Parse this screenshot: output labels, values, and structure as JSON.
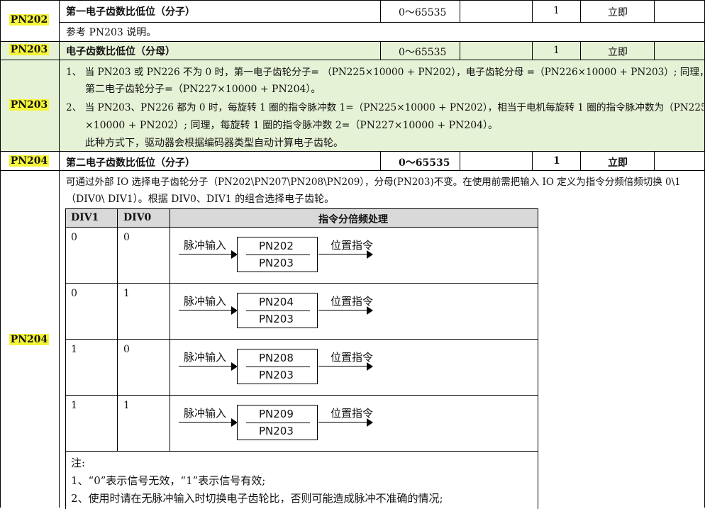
{
  "rows": {
    "pn202": {
      "param": "PN202",
      "name": "第一电子齿数比低位（分子）",
      "range": "0～65535",
      "unit": "",
      "default": "1",
      "effect": "立即",
      "desc": "参考 PN203 说明。"
    },
    "pn203": {
      "param": "PN203",
      "name": "电子齿数比低位（分母）",
      "range": "0～65535",
      "unit": "",
      "default": "1",
      "effect": "立即",
      "param_desc": "PN203",
      "desc_lines": [
        "1、  当 PN203 或 PN226 不为 0 时，第一电子齿轮分子=  （PN225×10000 + PN202），电子齿轮分母 =（PN226×10000 + PN203）; 同理，",
        "第二电子齿轮分子=（PN227×10000 + PN204）。",
        "2、  当 PN203、PN226 都为 0 时，每旋转 1 圈的指令脉冲数 1=（PN225×10000 + PN202），相当于电机每旋转 1 圈的指令脉冲数为（PN225",
        "×10000 + PN202）; 同理，每旋转 1 圈的指令脉冲数 2=（PN227×10000 + PN204）。",
        "此种方式下，驱动器会根据编码器类型自动计算电子齿轮。"
      ]
    },
    "pn204": {
      "param": "PN204",
      "name": "第二电子齿数比低位（分子）",
      "range": "0～65535",
      "unit": "",
      "default": "1",
      "effect": "立即",
      "param_desc": "PN204",
      "desc_lines": [
        "可通过外部 IO 选择电子齿轮分子（PN202\\PN207\\PN208\\PN209），分母(PN203)不变。在使用前需把输入 IO 定义为指令分频倍频切换 0\\1",
        "（DIV0\\ DIV1）。根据 DIV0、DIV1 的组合选择电子齿轮。"
      ]
    }
  },
  "inner_table": {
    "headers": [
      "DIV1",
      "DIV0",
      "指令分倍频处理"
    ],
    "rows": [
      {
        "div1": "0",
        "div0": "0",
        "numerator": "PN202",
        "denominator": "PN203"
      },
      {
        "div1": "0",
        "div0": "1",
        "numerator": "PN204",
        "denominator": "PN203"
      },
      {
        "div1": "1",
        "div0": "0",
        "numerator": "PN208",
        "denominator": "PN203"
      },
      {
        "div1": "1",
        "div0": "1",
        "numerator": "PN209",
        "denominator": "PN203"
      }
    ],
    "input_label": "脉冲输入",
    "output_label": "位置指令"
  },
  "notes": {
    "title": "注:",
    "items": [
      "1、“0”表示信号无效，“1”表示信号有效;",
      "2、使用时请在无脉冲输入时切换电子齿轮比，否则可能造成脉冲不准确的情况;"
    ]
  },
  "colors": {
    "highlight": "#f5f53a",
    "green_bg": "#e6f2d6",
    "header_gray": "#d9d9d9"
  }
}
